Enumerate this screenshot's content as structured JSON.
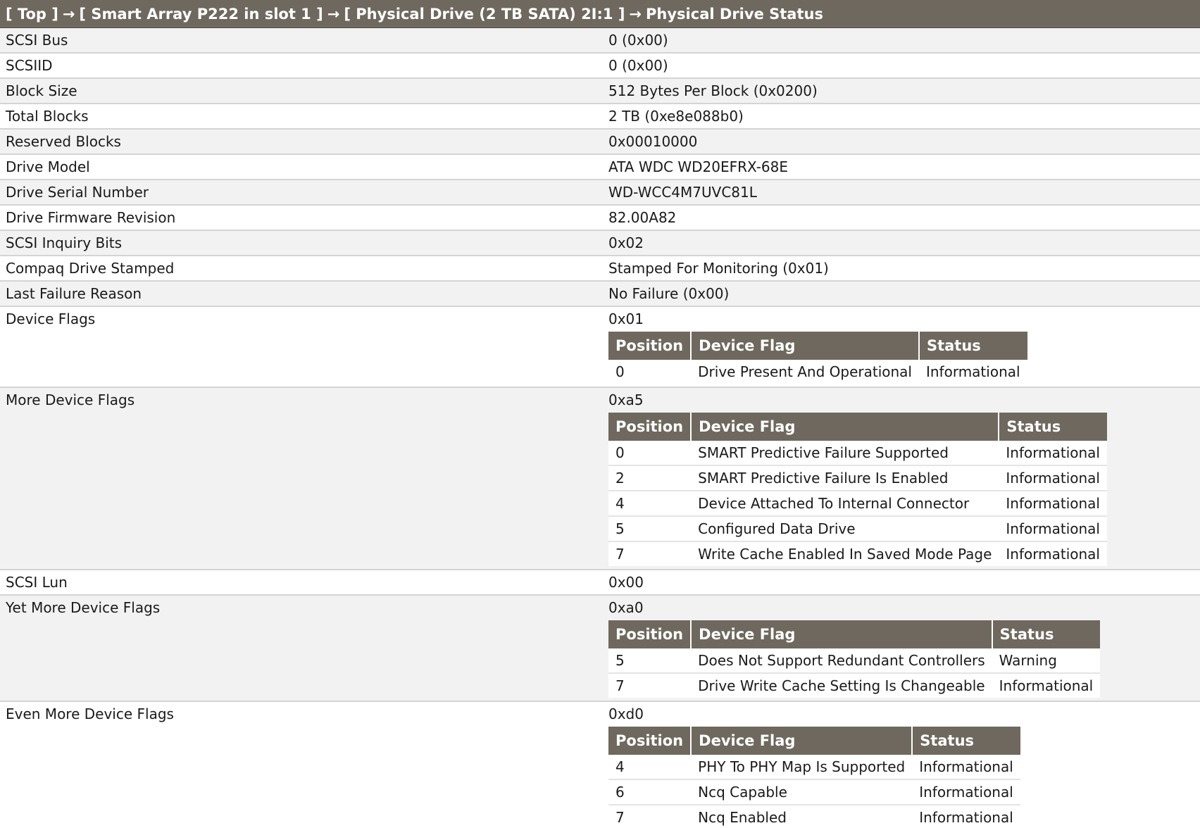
{
  "breadcrumb": {
    "items": [
      "[ Top ]",
      "[ Smart Array P222 in slot 1 ]",
      "[ Physical Drive (2 TB SATA) 2I:1 ]",
      "Physical Drive Status"
    ],
    "separator": "→"
  },
  "rows": [
    {
      "label": "SCSI Bus",
      "value": "0 (0x00)"
    },
    {
      "label": "SCSIID",
      "value": "0 (0x00)"
    },
    {
      "label": "Block Size",
      "value": "512 Bytes Per Block (0x0200)"
    },
    {
      "label": "Total Blocks",
      "value": "2 TB (0xe8e088b0)"
    },
    {
      "label": "Reserved Blocks",
      "value": "0x00010000"
    },
    {
      "label": "Drive Model",
      "value": "ATA WDC WD20EFRX-68E"
    },
    {
      "label": "Drive Serial Number",
      "value": "WD-WCC4M7UVC81L"
    },
    {
      "label": "Drive Firmware Revision",
      "value": "82.00A82"
    },
    {
      "label": "SCSI Inquiry Bits",
      "value": "0x02"
    },
    {
      "label": "Compaq Drive Stamped",
      "value": "Stamped For Monitoring (0x01)"
    },
    {
      "label": "Last Failure Reason",
      "value": "No Failure (0x00)"
    }
  ],
  "flag_table_headers": {
    "position": "Position",
    "device_flag": "Device Flag",
    "status": "Status"
  },
  "device_flags": {
    "label": "Device Flags",
    "value": "0x01",
    "entries": [
      {
        "position": "0",
        "flag": "Drive Present And Operational",
        "status": "Informational"
      }
    ]
  },
  "more_device_flags": {
    "label": "More Device Flags",
    "value": "0xa5",
    "entries": [
      {
        "position": "0",
        "flag": "SMART Predictive Failure Supported",
        "status": "Informational"
      },
      {
        "position": "2",
        "flag": "SMART Predictive Failure Is Enabled",
        "status": "Informational"
      },
      {
        "position": "4",
        "flag": "Device Attached To Internal Connector",
        "status": "Informational"
      },
      {
        "position": "5",
        "flag": "Configured Data Drive",
        "status": "Informational"
      },
      {
        "position": "7",
        "flag": "Write Cache Enabled In Saved Mode Page",
        "status": "Informational"
      }
    ]
  },
  "scsi_lun": {
    "label": "SCSI Lun",
    "value": "0x00"
  },
  "yet_more_device_flags": {
    "label": "Yet More Device Flags",
    "value": "0xa0",
    "entries": [
      {
        "position": "5",
        "flag": "Does Not Support Redundant Controllers",
        "status": "Warning"
      },
      {
        "position": "7",
        "flag": "Drive Write Cache Setting Is Changeable",
        "status": "Informational"
      }
    ]
  },
  "even_more_device_flags": {
    "label": "Even More Device Flags",
    "value": "0xd0",
    "entries": [
      {
        "position": "4",
        "flag": "PHY To PHY Map Is Supported",
        "status": "Informational"
      },
      {
        "position": "6",
        "flag": "Ncq Capable",
        "status": "Informational"
      },
      {
        "position": "7",
        "flag": "Ncq Enabled",
        "status": "Informational"
      }
    ]
  },
  "colors": {
    "header_bg": "#6e685e",
    "row_alt_bg": "#f2f2f2"
  }
}
